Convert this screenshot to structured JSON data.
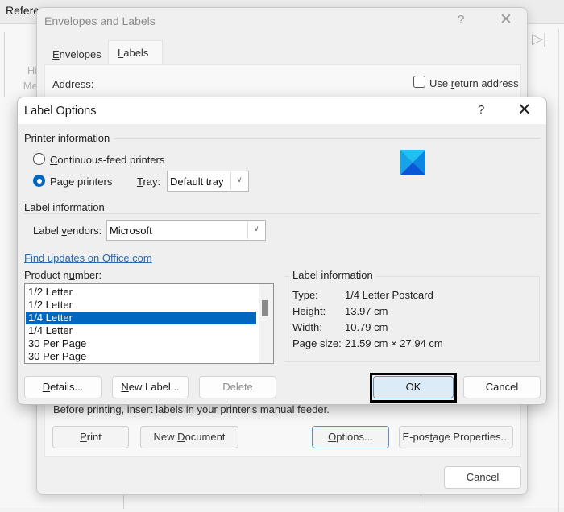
{
  "background": {
    "ribbon_tab": "References",
    "ghost_text_line1": "Hi",
    "ghost_text_line2": "Mer",
    "end_icon": "next-record-icon"
  },
  "envelopes_dialog": {
    "title": "Envelopes and Labels",
    "help_label": "?",
    "close_label": "✕",
    "tabs": [
      {
        "label": "Envelopes",
        "accel": "E",
        "rest": "nvelopes",
        "active": false
      },
      {
        "label": "Labels",
        "accel": "L",
        "rest": "abels",
        "active": true
      }
    ],
    "address_label_accel": "A",
    "address_label_rest": "ddress:",
    "use_return_address": {
      "pre": "Use ",
      "accel": "r",
      "post": "eturn address",
      "checked": false
    },
    "feeder_text": "Before printing, insert labels in your printer's manual feeder.",
    "buttons": {
      "print": {
        "accel": "P",
        "rest": "rint"
      },
      "new_document": {
        "pre": "New ",
        "accel": "D",
        "rest": "ocument"
      },
      "options": {
        "accel": "O",
        "rest": "ptions..."
      },
      "epostage": {
        "pre": "E-pos",
        "accel": "t",
        "rest": "age Properties..."
      },
      "cancel": "Cancel"
    }
  },
  "label_options": {
    "title": "Label Options",
    "help_label": "?",
    "close_label": "✕",
    "printer_information": {
      "group_label": "Printer information",
      "options": [
        {
          "accel": "C",
          "rest": "ontinuous-feed printers",
          "checked": false
        },
        {
          "pre": "Pa",
          "accel": "g",
          "rest": "e printers",
          "checked": true
        }
      ],
      "tray_label_accel": "T",
      "tray_label_rest": "ray:",
      "tray_value": "Default tray"
    },
    "label_information": {
      "group_label": "Label information",
      "vendors_label_pre": "Label ",
      "vendors_label_accel": "v",
      "vendors_label_rest": "endors:",
      "vendor_value": "Microsoft"
    },
    "find_updates_link": "Find updates on Office.com",
    "product_number_label": {
      "pre": "Product n",
      "accel": "u",
      "rest": "mber:"
    },
    "product_list": {
      "items": [
        "1/2 Letter",
        "1/2 Letter",
        "1/4 Letter",
        "1/4 Letter",
        "30 Per Page",
        "30 Per Page"
      ],
      "selected_index": 2
    },
    "label_info_panel": {
      "title": "Label information",
      "rows": [
        {
          "key": "Type:",
          "value": "1/4 Letter Postcard"
        },
        {
          "key": "Height:",
          "value": "13.97 cm"
        },
        {
          "key": "Width:",
          "value": "10.79 cm"
        },
        {
          "key": "Page size:",
          "value": "21.59 cm × 27.94 cm"
        }
      ]
    },
    "buttons": {
      "details": {
        "accel": "D",
        "rest": "etails..."
      },
      "new_label": {
        "accel": "N",
        "rest": "ew Label..."
      },
      "delete": "Delete",
      "ok": "OK",
      "cancel": "Cancel"
    },
    "colors": {
      "accent": "#0067c0",
      "link": "#2b67b3",
      "ok_focus_outline": "#000000"
    }
  }
}
